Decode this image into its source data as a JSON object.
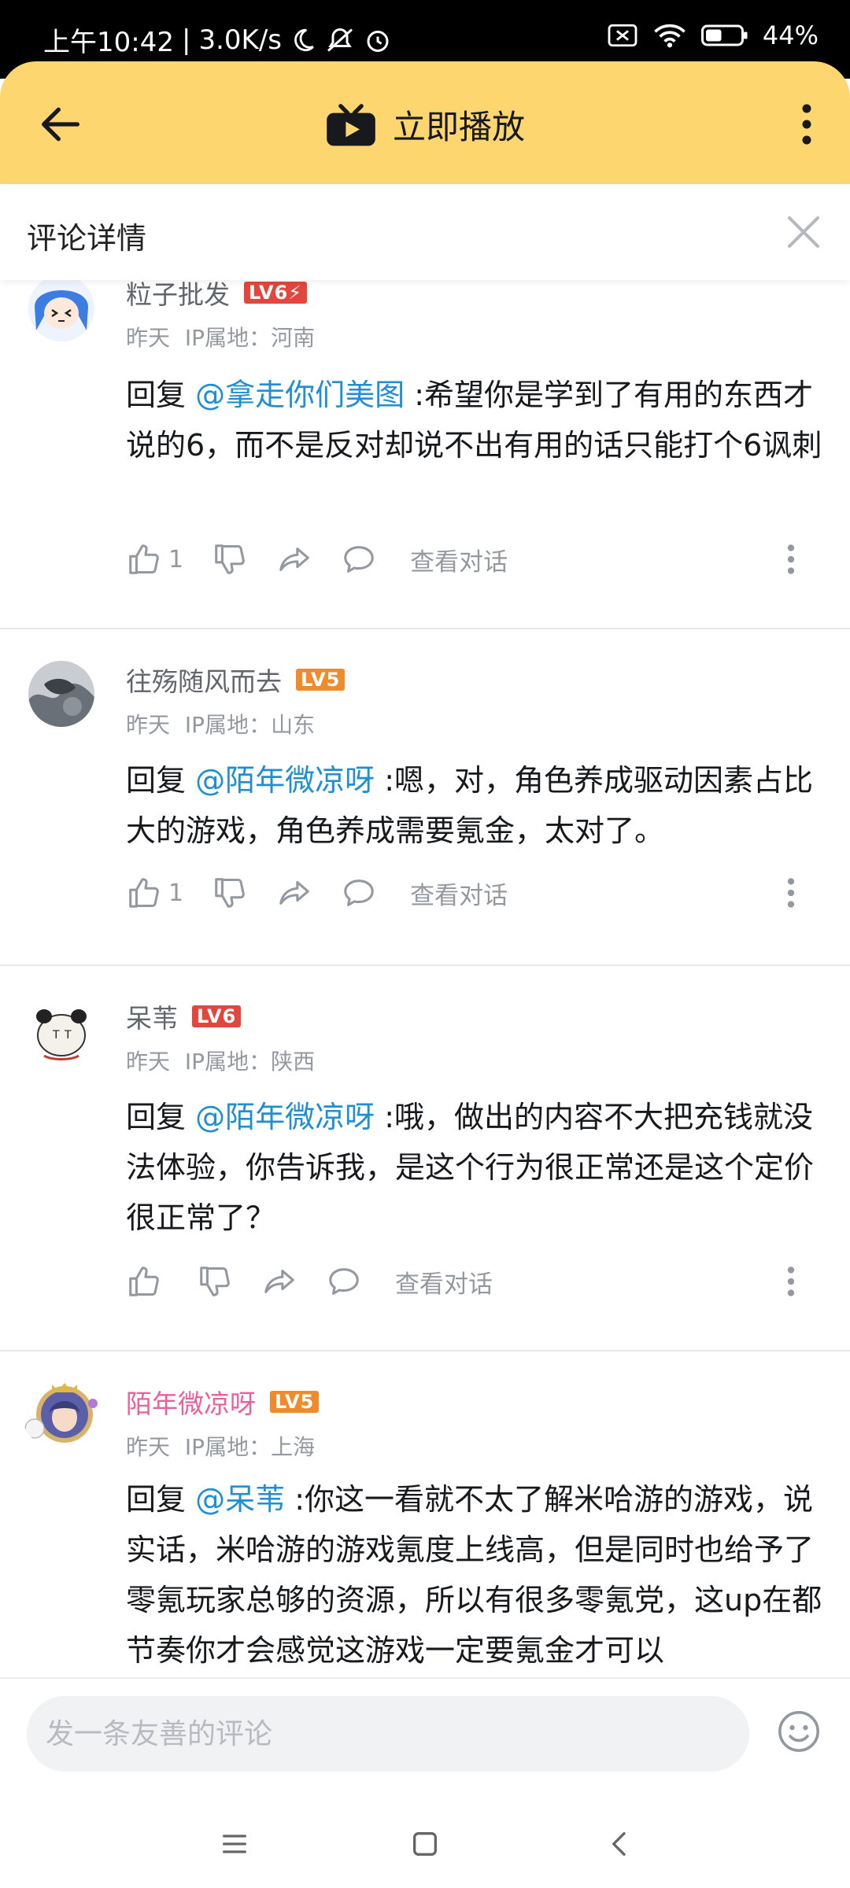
{
  "status_bar": {
    "time": "上午10:42",
    "separator": "|",
    "speed": "3.0K/s",
    "battery": "44%"
  },
  "header": {
    "title": "立即播放"
  },
  "detail": {
    "title": "评论详情"
  },
  "reply_prefix": "回复",
  "view_conversation": "查看对话",
  "comments": [
    {
      "username": "粒子批发",
      "level": "LV6⚡",
      "time": "昨天",
      "ip": "IP属地：河南",
      "at": "@拿走你们美图",
      "text": ":希望你是学到了有用的东西才说的6，而不是反对却说不出有用的话只能打个6讽刺",
      "likes": "1"
    },
    {
      "username": "往殇随风而去",
      "level": "LV5",
      "time": "昨天",
      "ip": "IP属地：山东",
      "at": "@陌年微凉呀",
      "text": ":嗯，对，角色养成驱动因素占比大的游戏，角色养成需要氪金，太对了。",
      "likes": "1"
    },
    {
      "username": "呆苇",
      "level": "LV6",
      "time": "昨天",
      "ip": "IP属地：陕西",
      "at": "@陌年微凉呀",
      "text": ":哦，做出的内容不大把充钱就没法体验，你告诉我，是这个行为很正常还是这个定价很正常了？",
      "likes": ""
    },
    {
      "username": "陌年微凉呀",
      "level": "LV5",
      "time": "昨天",
      "ip": "IP属地：上海",
      "at": "@呆苇",
      "text": ":你这一看就不太了解米哈游的游戏，说实话，米哈游的游戏氪度上线高，但是同时也给予了零氪玩家总够的资源，所以有很多零氪党，这up在都节奏你才会感觉这游戏一定要氪金才可以",
      "likes": ""
    }
  ],
  "input": {
    "placeholder": "发一条友善的评论"
  },
  "colors": {
    "header_bg": "#fdd66f",
    "mention": "#1e8fd5",
    "pink_name": "#ee5e98",
    "lv6": "#e2463c",
    "lv5": "#f08b2c"
  }
}
